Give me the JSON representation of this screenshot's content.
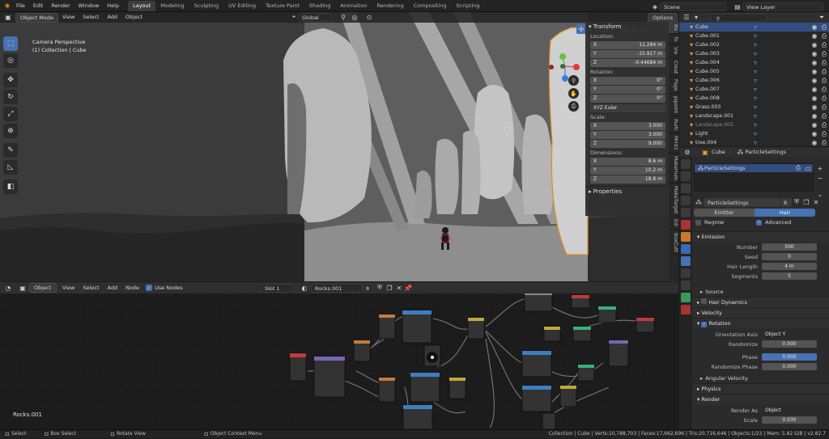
{
  "topbar": {
    "menus": [
      "File",
      "Edit",
      "Render",
      "Window",
      "Help"
    ],
    "workspaces": [
      "Layout",
      "Modeling",
      "Sculpting",
      "UV Editing",
      "Texture Paint",
      "Shading",
      "Animation",
      "Rendering",
      "Compositing",
      "Scripting"
    ],
    "active_workspace": "Layout",
    "scene": "Scene",
    "view_layer": "View Layer"
  },
  "viewport": {
    "mode": "Object Mode",
    "menus": [
      "View",
      "Select",
      "Add",
      "Object"
    ],
    "orientation": "Global",
    "options": "Options",
    "overlay_line1": "Camera Perspective",
    "overlay_line2": "(1) Collection | Cube"
  },
  "npanel": {
    "transform": "Transform",
    "location": "Location:",
    "loc": [
      {
        "a": "X",
        "v": "11.284 m"
      },
      {
        "a": "Y",
        "v": "-15.917 m"
      },
      {
        "a": "Z",
        "v": "-0.44684 m"
      }
    ],
    "rotation": "Rotation:",
    "rot": [
      {
        "a": "X",
        "v": "0°"
      },
      {
        "a": "Y",
        "v": "0°"
      },
      {
        "a": "Z",
        "v": "0°"
      }
    ],
    "euler": "XYZ Euler",
    "scale": "Scale:",
    "scl": [
      {
        "a": "X",
        "v": "3.000"
      },
      {
        "a": "Y",
        "v": "3.000"
      },
      {
        "a": "Z",
        "v": "9.000"
      }
    ],
    "dimensions": "Dimensions:",
    "dim": [
      {
        "a": "X",
        "v": "8.6 m"
      },
      {
        "a": "Y",
        "v": "10.2 m"
      },
      {
        "a": "Z",
        "v": "18.8 m"
      }
    ],
    "properties": "Properties",
    "tabs": [
      "Ite",
      "To",
      "Vie",
      "Creat",
      "Page",
      "pipeint",
      "Rurti",
      "MHX2",
      "MakeHum",
      "MakeTarget",
      "Edi",
      "BoxCutt"
    ]
  },
  "nodes": {
    "type": "Object",
    "menus": [
      "View",
      "Select",
      "Add",
      "Node"
    ],
    "use_nodes": "Use Nodes",
    "slot": "Slot 1",
    "material": "Rocks.001",
    "users": "8",
    "label": "Rocks.001"
  },
  "outliner": {
    "items": [
      {
        "name": "Cube",
        "sel": true
      },
      {
        "name": "Cube.001"
      },
      {
        "name": "Cube.002"
      },
      {
        "name": "Cube.003"
      },
      {
        "name": "Cube.004"
      },
      {
        "name": "Cube.005"
      },
      {
        "name": "Cube.006"
      },
      {
        "name": "Cube.007"
      },
      {
        "name": "Cube.008"
      },
      {
        "name": "Grass.003"
      },
      {
        "name": "Landscape.001"
      },
      {
        "name": "Landscape.002",
        "dim": true
      },
      {
        "name": "Light"
      },
      {
        "name": "tree.004"
      }
    ]
  },
  "props": {
    "object": "Cube",
    "psys": "ParticleSettings",
    "list_item": "ParticleSettings",
    "datablock": "ParticleSettings",
    "users": "8",
    "emitter": "Emitter",
    "hair": "Hair",
    "regrow": "Regrow",
    "advanced": "Advanced",
    "emission": "Emission",
    "number_l": "Number",
    "number": "500",
    "seed_l": "Seed",
    "seed": "0",
    "hairlen_l": "Hair Length",
    "hairlen": "4 m",
    "segments_l": "Segments",
    "segments": "5",
    "source": "Source",
    "hair_dynamics": "Hair Dynamics",
    "velocity": "Velocity",
    "rotation": "Rotation",
    "orient_l": "Orientation Axis",
    "orient": "Object Y",
    "randomize_l": "Randomize",
    "randomize": "0.000",
    "phase_l": "Phase",
    "phase": "0.000",
    "rphase_l": "Randomize Phase",
    "rphase": "0.000",
    "angular": "Angular Velocity",
    "physics": "Physics",
    "render": "Render",
    "renderas_l": "Render As",
    "renderas": "Object",
    "scale_l": "Scale",
    "scale": "0.030"
  },
  "status": {
    "select": "Select",
    "box": "Box Select",
    "rotate": "Rotate View",
    "ctx": "Object Context Menu",
    "info": "Collection | Cube | Verts:10,788,703 | Faces:17,662,696 | Tris:20,716,646 | Objects:1/23 | Mem: 5.82 GiB | v2.82.7"
  }
}
